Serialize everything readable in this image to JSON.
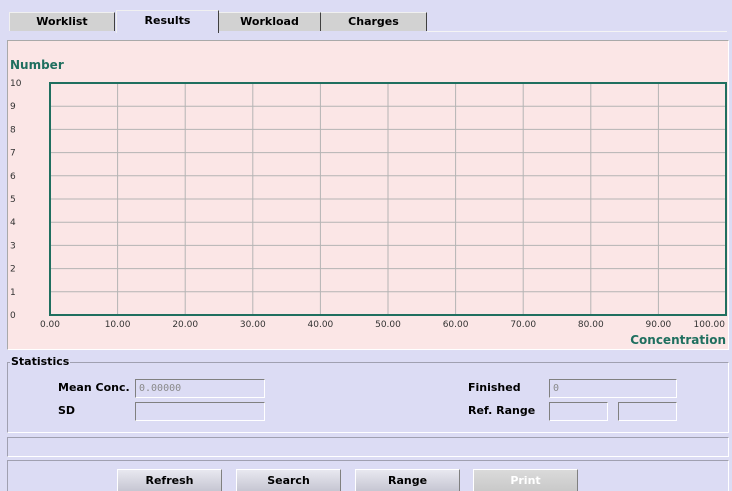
{
  "tabs": [
    {
      "label": "Worklist",
      "active": false
    },
    {
      "label": "Results",
      "active": true
    },
    {
      "label": "Workload",
      "active": false
    },
    {
      "label": "Charges",
      "active": false
    }
  ],
  "chart_data": {
    "type": "scatter",
    "ylabel": "Number",
    "xlabel": "Concentration",
    "xlim": [
      0,
      100
    ],
    "ylim": [
      0,
      10
    ],
    "x_ticks": [
      "0.00",
      "10.00",
      "20.00",
      "30.00",
      "40.00",
      "50.00",
      "60.00",
      "70.00",
      "80.00",
      "90.00",
      "100.00"
    ],
    "y_ticks": [
      "0",
      "1",
      "2",
      "3",
      "4",
      "5",
      "6",
      "7",
      "8",
      "9",
      "10"
    ],
    "series": [],
    "grid": true,
    "plot_bg": "#fbe6e6",
    "frame_color": "#1f6f5f"
  },
  "statistics": {
    "legend": "Statistics",
    "mean_conc_label": "Mean Conc.",
    "mean_conc_value": "0.00000",
    "sd_label": "SD",
    "sd_value": "",
    "finished_label": "Finished",
    "finished_value": "0",
    "ref_range_label": "Ref. Range",
    "ref_range_low": "",
    "ref_range_high": ""
  },
  "status_text": "",
  "buttons": {
    "refresh": "Refresh",
    "search": "Search",
    "range": "Range",
    "print": "Print"
  }
}
